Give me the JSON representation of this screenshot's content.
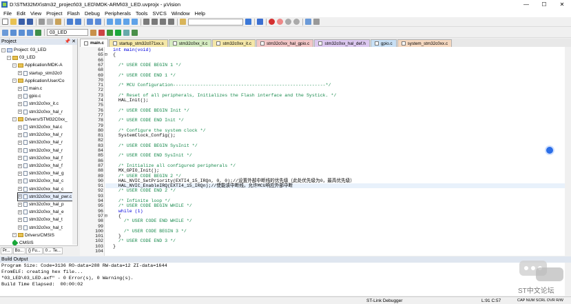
{
  "window": {
    "title": "D:\\STM32MX\\stm32_project\\03_LED\\MDK-ARM\\03_LED.uvprojx - µVision",
    "minimize": "—",
    "maximize": "☐",
    "close": "✕"
  },
  "menu": [
    "File",
    "Edit",
    "View",
    "Project",
    "Flash",
    "Debug",
    "Peripherals",
    "Tools",
    "SVCS",
    "Window",
    "Help"
  ],
  "toolbar": {
    "target": "03_LED"
  },
  "project": {
    "header": "Project",
    "pin": "📌",
    "closex": "✕",
    "items": [
      {
        "label": "Project: 03_LED",
        "kind": "root",
        "depth": 0,
        "icon": "project-icon"
      },
      {
        "label": "03_LED",
        "kind": "target",
        "depth": 1,
        "icon": "target-icon"
      },
      {
        "label": "Application/MDK-A",
        "kind": "folder",
        "depth": 2,
        "icon": "folder-icon"
      },
      {
        "label": "startup_stm32c0",
        "kind": "file",
        "depth": 3,
        "icon": "file-icon"
      },
      {
        "label": "Application/User/Co",
        "kind": "folder",
        "depth": 2,
        "icon": "folder-icon"
      },
      {
        "label": "main.c",
        "kind": "file",
        "depth": 3,
        "icon": "file-icon"
      },
      {
        "label": "gpio.c",
        "kind": "file",
        "depth": 3,
        "icon": "file-icon"
      },
      {
        "label": "stm32c0xx_it.c",
        "kind": "file",
        "depth": 3,
        "icon": "file-icon"
      },
      {
        "label": "stm32c0xx_hal_r",
        "kind": "file",
        "depth": 3,
        "icon": "file-icon"
      },
      {
        "label": "Drivers/STM32C0xx_",
        "kind": "folder",
        "depth": 2,
        "icon": "folder-icon"
      },
      {
        "label": "stm32c0xx_hal.c",
        "kind": "file",
        "depth": 3,
        "icon": "file-icon"
      },
      {
        "label": "stm32c0xx_hal_r",
        "kind": "file",
        "depth": 3,
        "icon": "file-icon"
      },
      {
        "label": "stm32c0xx_hal_r",
        "kind": "file",
        "depth": 3,
        "icon": "file-icon"
      },
      {
        "label": "stm32c0xx_hal_r",
        "kind": "file",
        "depth": 3,
        "icon": "file-icon"
      },
      {
        "label": "stm32c0xx_hal_f",
        "kind": "file",
        "depth": 3,
        "icon": "file-icon"
      },
      {
        "label": "stm32c0xx_hal_f",
        "kind": "file",
        "depth": 3,
        "icon": "file-icon"
      },
      {
        "label": "stm32c0xx_hal_g",
        "kind": "file",
        "depth": 3,
        "icon": "file-icon"
      },
      {
        "label": "stm32c0xx_hal_c",
        "kind": "file",
        "depth": 3,
        "icon": "file-icon"
      },
      {
        "label": "stm32c0xx_hal_c",
        "kind": "file",
        "depth": 3,
        "icon": "file-icon"
      },
      {
        "label": "stm32c0xx_hal_pwr.c",
        "kind": "file",
        "depth": 3,
        "icon": "file-icon",
        "selected": true
      },
      {
        "label": "stm32c0xx_hal_p",
        "kind": "file",
        "depth": 3,
        "icon": "file-icon"
      },
      {
        "label": "stm32c0xx_hal_e",
        "kind": "file",
        "depth": 3,
        "icon": "file-icon"
      },
      {
        "label": "stm32c0xx_hal_t",
        "kind": "file",
        "depth": 3,
        "icon": "file-icon"
      },
      {
        "label": "stm32c0xx_hal_t",
        "kind": "file",
        "depth": 3,
        "icon": "file-icon"
      },
      {
        "label": "Drivers/CMSIS",
        "kind": "folder",
        "depth": 2,
        "icon": "folder-icon"
      },
      {
        "label": "CMSIS",
        "kind": "gem",
        "depth": 2,
        "icon": "cmsis-gem-icon"
      }
    ],
    "tabs": [
      "Pr...",
      "Bo...",
      "{} Fu...",
      "0→ Te..."
    ]
  },
  "tabs": [
    {
      "label": "main.c",
      "color": "#ffffff",
      "active": true
    },
    {
      "label": "startup_stm32c071xx.s",
      "color": "#f5e7a8"
    },
    {
      "label": "stm32c0xx_it.c",
      "color": "#d6ecc2"
    },
    {
      "label": "stm32c0xx_it.c",
      "color": "#f5e7a8"
    },
    {
      "label": "stm32c0xx_hal_gpio.c",
      "color": "#f3c7c7"
    },
    {
      "label": "stm32c0xx_hal_def.h",
      "color": "#dcc8f0"
    },
    {
      "label": "gpio.c",
      "color": "#c8e0f5"
    },
    {
      "label": "system_stm32c0xx.c",
      "color": "#f5d8c0"
    }
  ],
  "code": [
    {
      "n": "64",
      "t": "int main(void)",
      "c": "kw"
    },
    {
      "n": "65",
      "t": "{",
      "f": "⊟"
    },
    {
      "n": "66",
      "t": ""
    },
    {
      "n": "67",
      "t": "  /* USER CODE BEGIN 1 */",
      "c": "cm"
    },
    {
      "n": "68",
      "t": ""
    },
    {
      "n": "69",
      "t": "  /* USER CODE END 1 */",
      "c": "cm"
    },
    {
      "n": "70",
      "t": ""
    },
    {
      "n": "71",
      "t": "  /* MCU Configuration--------------------------------------------------------*/",
      "c": "cm"
    },
    {
      "n": "72",
      "t": ""
    },
    {
      "n": "73",
      "t": "  /* Reset of all peripherals, Initializes the Flash interface and the Systick. */",
      "c": "cm"
    },
    {
      "n": "74",
      "t": "  HAL_Init();"
    },
    {
      "n": "75",
      "t": ""
    },
    {
      "n": "76",
      "t": "  /* USER CODE BEGIN Init */",
      "c": "cm"
    },
    {
      "n": "77",
      "t": ""
    },
    {
      "n": "78",
      "t": "  /* USER CODE END Init */",
      "c": "cm"
    },
    {
      "n": "79",
      "t": ""
    },
    {
      "n": "80",
      "t": "  /* Configure the system clock */",
      "c": "cm"
    },
    {
      "n": "81",
      "t": "  SystemClock_Config();"
    },
    {
      "n": "82",
      "t": ""
    },
    {
      "n": "83",
      "t": "  /* USER CODE BEGIN SysInit */",
      "c": "cm"
    },
    {
      "n": "84",
      "t": ""
    },
    {
      "n": "85",
      "t": "  /* USER CODE END SysInit */",
      "c": "cm"
    },
    {
      "n": "86",
      "t": ""
    },
    {
      "n": "87",
      "t": "  /* Initialize all configured peripherals */",
      "c": "cm"
    },
    {
      "n": "88",
      "t": "  MX_GPIO_Init();"
    },
    {
      "n": "89",
      "t": "  /* USER CODE BEGIN 2 */",
      "c": "cm"
    },
    {
      "n": "90",
      "t": "  HAL_NVIC_SetPriority(EXTI4_15_IRQn, 0, 0);//设置外部中断线的优先级（此处优先级为0，最高优先级）"
    },
    {
      "n": "91",
      "t": "  HAL_NVIC_EnableIRQ(EXTI4_15_IRQn);//使能该中断线，允许MCU响应外部中断",
      "cur": true
    },
    {
      "n": "92",
      "t": "  /* USER CODE END 2 */",
      "c": "cm"
    },
    {
      "n": "93",
      "t": ""
    },
    {
      "n": "94",
      "t": "  /* Infinite loop */",
      "c": "cm"
    },
    {
      "n": "95",
      "t": "  /* USER CODE BEGIN WHILE */",
      "c": "cm"
    },
    {
      "n": "96",
      "t": "  while (1)",
      "c": "kw"
    },
    {
      "n": "97",
      "t": "  {",
      "f": "⊟"
    },
    {
      "n": "98",
      "t": "    /* USER CODE END WHILE */",
      "c": "cm"
    },
    {
      "n": "99",
      "t": ""
    },
    {
      "n": "100",
      "t": "    /* USER CODE BEGIN 3 */",
      "c": "cm"
    },
    {
      "n": "101",
      "t": "  }"
    },
    {
      "n": "102",
      "t": "  /* USER CODE END 3 */",
      "c": "cm"
    },
    {
      "n": "103",
      "t": "}"
    },
    {
      "n": "104",
      "t": ""
    }
  ],
  "build": {
    "header": "Build Output",
    "lines": [
      "Program Size: Code=3136 RO-data=288 RW-data=12 ZI-data=1644",
      "FromELF: creating hex file...",
      "\"03_LED\\03_LED.axf\" - 0 Error(s), 0 Warning(s).",
      "Build Time Elapsed:  00:00:02"
    ]
  },
  "status": {
    "debugger": "ST-Link Debugger",
    "position": "L:91 C:57",
    "keys": "CAP NUM SCRL OVR R/W"
  },
  "watermark": {
    "text": "ST中文论坛"
  }
}
